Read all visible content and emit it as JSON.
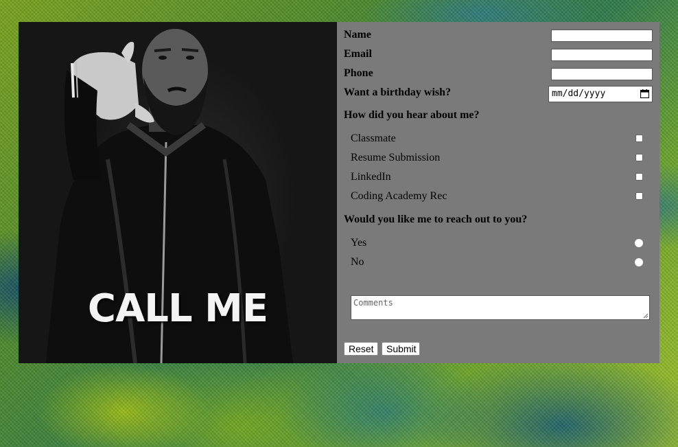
{
  "image": {
    "caption": "CALL ME"
  },
  "form": {
    "fields": [
      {
        "label": "Name",
        "value": ""
      },
      {
        "label": "Email",
        "value": ""
      },
      {
        "label": "Phone",
        "value": ""
      }
    ],
    "birthday": {
      "label": "Want a birthday wish?",
      "placeholder": "mm/dd/yyyy"
    },
    "hear_about": {
      "heading": "How did you hear about me?",
      "options": [
        "Classmate",
        "Resume Submission",
        "LinkedIn",
        "Coding Academy Rec"
      ]
    },
    "reach_out": {
      "heading": "Would you like me to reach out to you?",
      "options": [
        "Yes",
        "No"
      ]
    },
    "comments": {
      "placeholder": "Comments"
    },
    "buttons": {
      "reset": "Reset",
      "submit": "Submit"
    }
  },
  "icons": {
    "date_picker": "calendar-icon",
    "textarea_resize": "resize-handle-icon"
  },
  "colors": {
    "card": "#7a7a7a",
    "photo_bg": "#1a1a1a",
    "caption": "#f4f4f4"
  }
}
